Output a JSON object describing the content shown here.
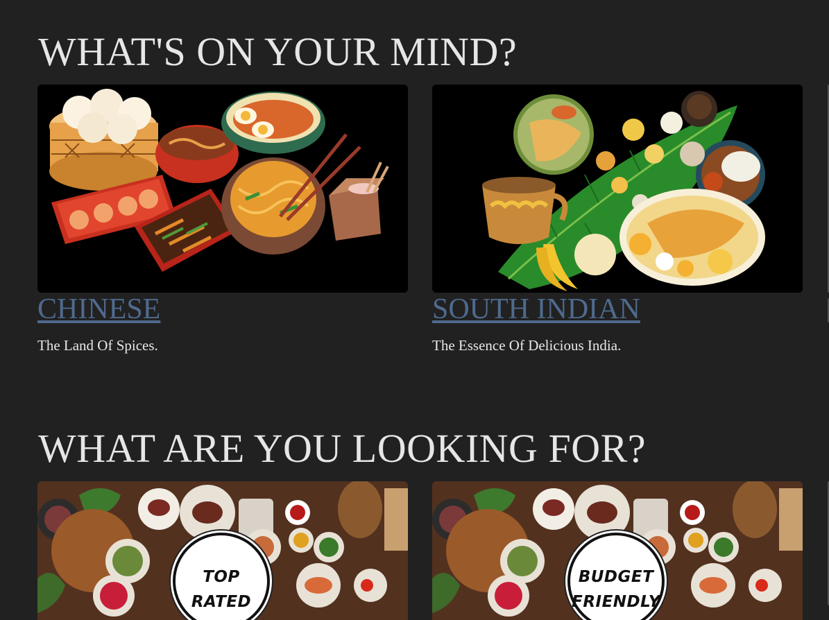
{
  "sections": {
    "mind_title": "WHAT'S ON YOUR MIND?",
    "looking_title": "WHAT ARE YOU LOOKING FOR?"
  },
  "cuisines": [
    {
      "name": "CHINESE",
      "tagline": "The Land Of Spices."
    },
    {
      "name": "SOUTH INDIAN",
      "tagline": "The Essence Of Delicious India."
    }
  ],
  "categories": [
    {
      "badge_line1": "TOP",
      "badge_line2": "RATED"
    },
    {
      "badge_line1": "BUDGET",
      "badge_line2": "FRIENDLY"
    }
  ],
  "colors": {
    "background": "#212121",
    "link": "#4f6a8e",
    "heading": "#e6e6e6"
  }
}
